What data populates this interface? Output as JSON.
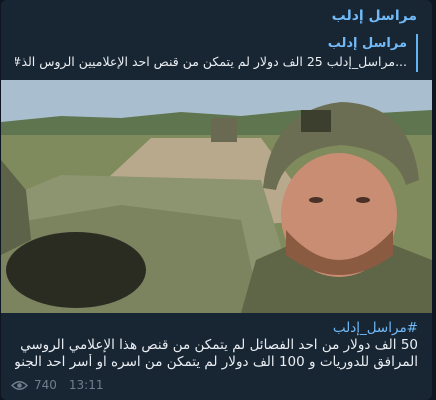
{
  "channel": {
    "name": "مراسل إدلب"
  },
  "reply": {
    "title": "مراسل إدلب",
    "text": "...مراسل_إدلب 25 الف دولار لم يتمكن من قنص احد الإعلاميين الروس الذ#"
  },
  "media": {
    "description_icon": "video-frame"
  },
  "caption": {
    "hashtag": "#مراسل_إدلب",
    "line1": "50 الف دولار من احد الفصائل لم يتمكن من قنص هذا الإعلامي الروسي",
    "line2": "المرافق للدوريات و 100 الف دولار لم يتمكن من اسره او أسر احد الجنود الروس"
  },
  "meta": {
    "views": "740",
    "time": "13:11",
    "views_icon": "eye-icon"
  },
  "colors": {
    "background": "#0e1621",
    "bubble": "#182533",
    "accent": "#71baf7",
    "text": "#e9eef3",
    "muted": "#6d7f8f"
  }
}
